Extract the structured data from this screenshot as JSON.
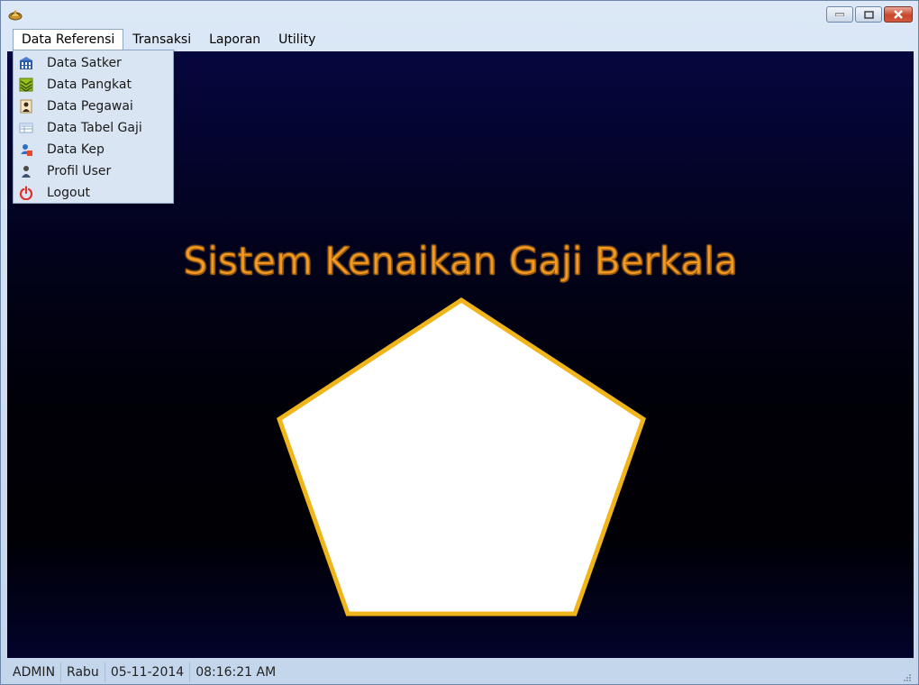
{
  "window": {
    "title": "",
    "controls": {
      "minimize": "minimize-icon",
      "maximize": "maximize-icon",
      "close": "close-icon"
    }
  },
  "menubar": {
    "items": [
      {
        "label": "Data Referensi",
        "active": true
      },
      {
        "label": "Transaksi",
        "active": false
      },
      {
        "label": "Laporan",
        "active": false
      },
      {
        "label": "Utility",
        "active": false
      }
    ]
  },
  "dropdown": {
    "items": [
      {
        "label": "Data Satker",
        "icon": "building-icon"
      },
      {
        "label": "Data Pangkat",
        "icon": "rank-insignia-icon"
      },
      {
        "label": "Data Pegawai",
        "icon": "employee-icon"
      },
      {
        "label": "Data Tabel Gaji",
        "icon": "table-icon"
      },
      {
        "label": "Data Kep",
        "icon": "document-user-icon"
      },
      {
        "label": "Profil User",
        "icon": "user-icon"
      },
      {
        "label": "Logout",
        "icon": "power-icon"
      }
    ]
  },
  "main": {
    "title": "Sistem Kenaikan Gaji Berkala",
    "title_color": "#f19a27",
    "logo": "pentagon-logo"
  },
  "statusbar": {
    "user": "ADMIN",
    "day": "Rabu",
    "date": "05-11-2014",
    "time": "08:16:21 AM"
  },
  "colors": {
    "background": "#000008",
    "accent": "#f1b51c",
    "logo_fill": "#ffffff"
  }
}
